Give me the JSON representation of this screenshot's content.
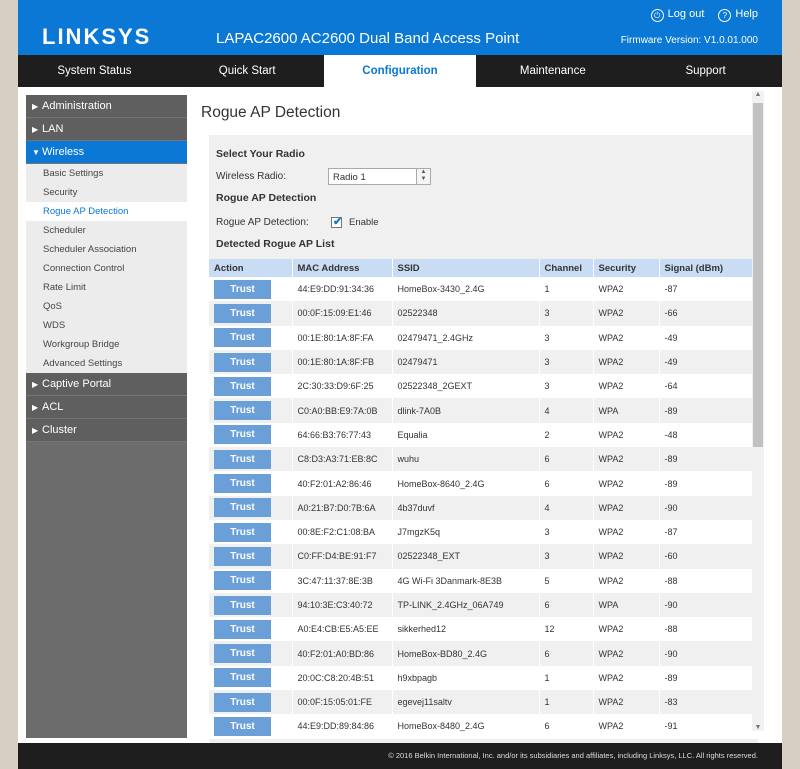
{
  "header": {
    "logo": "LINKSYS",
    "product": "LAPAC2600 AC2600 Dual Band Access Point",
    "logout": "Log out",
    "help": "Help",
    "firmware": "Firmware Version: V1.0.01.000"
  },
  "nav": [
    "System Status",
    "Quick Start",
    "Configuration",
    "Maintenance",
    "Support"
  ],
  "sidebar": {
    "administration": "Administration",
    "lan": "LAN",
    "wireless": "Wireless",
    "wireless_items": [
      "Basic Settings",
      "Security",
      "Rogue AP Detection",
      "Scheduler",
      "Scheduler Association",
      "Connection Control",
      "Rate Limit",
      "QoS",
      "WDS",
      "Workgroup Bridge",
      "Advanced Settings"
    ],
    "captive_portal": "Captive Portal",
    "acl": "ACL",
    "cluster": "Cluster"
  },
  "page": {
    "title": "Rogue AP Detection",
    "select_radio_title": "Select Your Radio",
    "wireless_radio_label": "Wireless Radio:",
    "wireless_radio_value": "Radio 1",
    "rogue_section_title": "Rogue AP Detection",
    "rogue_label": "Rogue AP Detection:",
    "enable_label": "Enable",
    "list_title": "Detected Rogue AP List"
  },
  "table": {
    "headers": [
      "Action",
      "MAC Address",
      "SSID",
      "Channel",
      "Security",
      "Signal (dBm)"
    ],
    "button_label": "Trust",
    "rows": [
      [
        "44:E9:DD:91:34:36",
        "HomeBox-3430_2.4G",
        "1",
        "WPA2",
        "-87"
      ],
      [
        "00:0F:15:09:E1:46",
        "02522348",
        "3",
        "WPA2",
        "-66"
      ],
      [
        "00:1E:80:1A:8F:FA",
        "02479471_2.4GHz",
        "3",
        "WPA2",
        "-49"
      ],
      [
        "00:1E:80:1A:8F:FB",
        "02479471",
        "3",
        "WPA2",
        "-49"
      ],
      [
        "2C:30:33:D9:6F:25",
        "02522348_2GEXT",
        "3",
        "WPA2",
        "-64"
      ],
      [
        "C0:A0:BB:E9:7A:0B",
        "dlink-7A0B",
        "4",
        "WPA",
        "-89"
      ],
      [
        "64:66:B3:76:77:43",
        "Equalia",
        "2",
        "WPA2",
        "-48"
      ],
      [
        "C8:D3:A3:71:EB:8C",
        "wuhu",
        "6",
        "WPA2",
        "-89"
      ],
      [
        "40:F2:01:A2:86:46",
        "HomeBox-8640_2.4G",
        "6",
        "WPA2",
        "-89"
      ],
      [
        "A0:21:B7:D0:7B:6A",
        "4b37duvf",
        "4",
        "WPA2",
        "-90"
      ],
      [
        "00:8E:F2:C1:08:BA",
        "J7mgzK5q",
        "3",
        "WPA2",
        "-87"
      ],
      [
        "C0:FF:D4:BE:91:F7",
        "02522348_EXT",
        "3",
        "WPA2",
        "-60"
      ],
      [
        "3C:47:11:37:8E:3B",
        "4G Wi-Fi 3Danmark-8E3B",
        "5",
        "WPA2",
        "-88"
      ],
      [
        "94:10:3E:C3:40:72",
        "TP-LINK_2.4GHz_06A749",
        "6",
        "WPA",
        "-90"
      ],
      [
        "A0:E4:CB:E5:A5:EE",
        "sikkerhed12",
        "12",
        "WPA2",
        "-88"
      ],
      [
        "40:F2:01:A0:BD:86",
        "HomeBox-BD80_2.4G",
        "6",
        "WPA2",
        "-90"
      ],
      [
        "20:0C:C8:20:4B:51",
        "h9xbpagb",
        "1",
        "WPA2",
        "-89"
      ],
      [
        "00:0F:15:05:01:FE",
        "egevej11saltv",
        "1",
        "WPA2",
        "-83"
      ],
      [
        "44:E9:DD:89:84:86",
        "HomeBox-8480_2.4G",
        "6",
        "WPA2",
        "-91"
      ]
    ]
  },
  "footer": "© 2016 Belkin International, Inc. and/or its subsidiaries and affiliates, including Linksys, LLC. All rights reserved."
}
